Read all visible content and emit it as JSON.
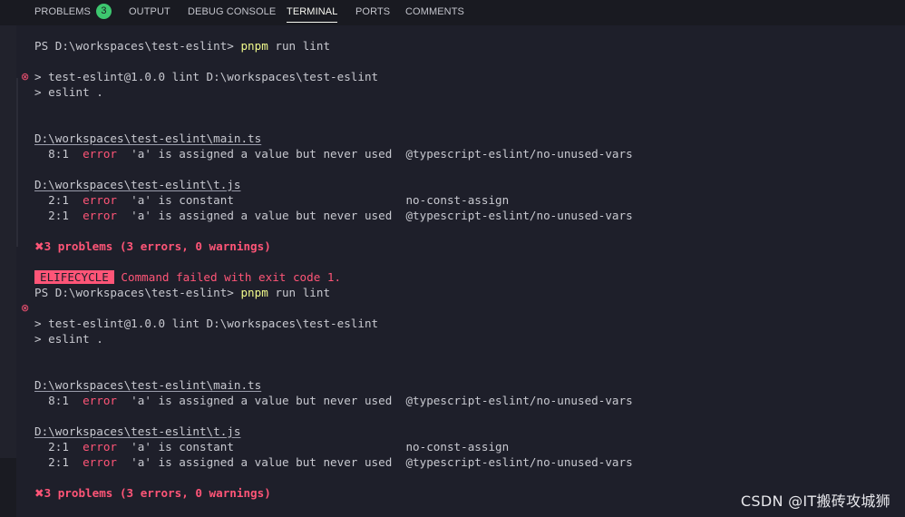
{
  "tabs": [
    {
      "label": "PROBLEMS",
      "badge": "3"
    },
    {
      "label": "OUTPUT"
    },
    {
      "label": "DEBUG CONSOLE"
    },
    {
      "label": "TERMINAL"
    },
    {
      "label": "PORTS"
    },
    {
      "label": "COMMENTS"
    }
  ],
  "terminal": {
    "prompt": "PS D:\\workspaces\\test-eslint> ",
    "command_bin": "pnpm",
    "command_args": " run lint",
    "pkg_line": "> test-eslint@1.0.0 lint D:\\workspaces\\test-eslint",
    "eslint_line": "> eslint .",
    "file_main": "D:\\workspaces\\test-eslint\\main.ts",
    "file_t": "D:\\workspaces\\test-eslint\\t.js",
    "rows": {
      "main_1": {
        "pos": "  8:1  ",
        "level": "error",
        "msg": "  'a' is assigned a value but never used  ",
        "rule": "@typescript-eslint/no-unused-vars"
      },
      "t_1": {
        "pos": "  2:1  ",
        "level": "error",
        "msg": "  'a' is constant                         ",
        "rule": "no-const-assign"
      },
      "t_2": {
        "pos": "  2:1  ",
        "level": "error",
        "msg": "  'a' is assigned a value but never used  ",
        "rule": "@typescript-eslint/no-unused-vars"
      }
    },
    "summary_icon": "✖",
    "summary": "3 problems (3 errors, 0 warnings)",
    "lifecycle_label": "ELIFECYCLE",
    "lifecycle_msg": " Command failed with exit code 1.",
    "error_marker": "⊗"
  },
  "watermark": "CSDN @IT搬砖攻城狮",
  "icons": {
    "error_circle": "error-circle-icon",
    "summary_x": "x-mark-icon"
  },
  "colors": {
    "background": "#1e1f2a",
    "header": "#191a21",
    "error": "#ff5577",
    "command": "#f1fa8c",
    "badge": "#3dc76f"
  }
}
